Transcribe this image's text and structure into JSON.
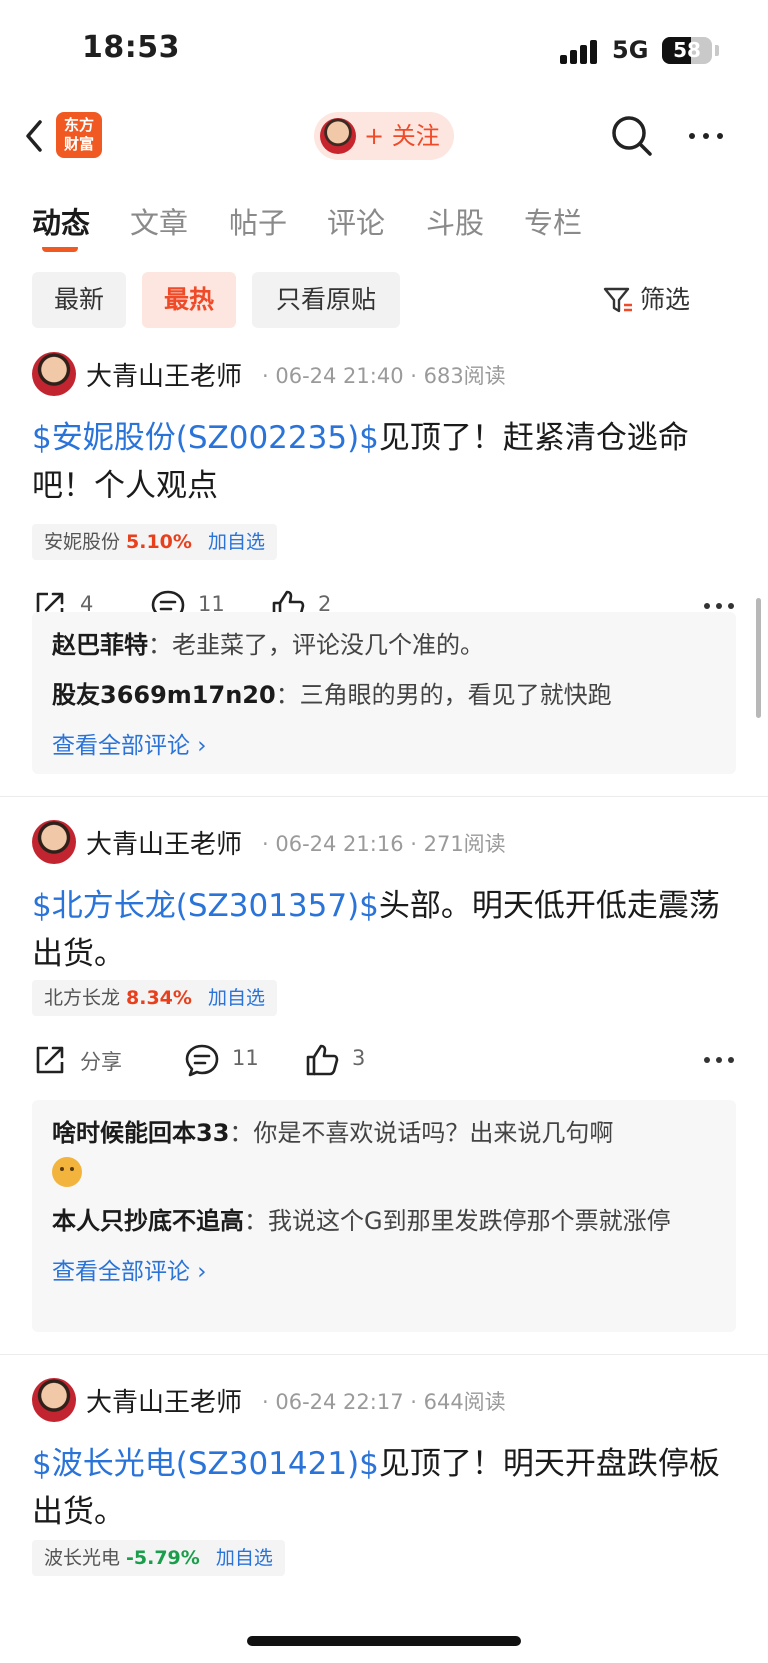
{
  "status_bar": {
    "time": "18:53",
    "network": "5G",
    "battery": "58",
    "battery_fraction": 0.58
  },
  "nav": {
    "logo_text_line1": "东方",
    "logo_text_line2": "财富",
    "follow_label": "+ 关注"
  },
  "tabs": [
    {
      "label": "动态",
      "active": true
    },
    {
      "label": "文章",
      "active": false
    },
    {
      "label": "帖子",
      "active": false
    },
    {
      "label": "评论",
      "active": false
    },
    {
      "label": "斗股",
      "active": false
    },
    {
      "label": "专栏",
      "active": false
    }
  ],
  "filters": {
    "items": [
      "最新",
      "最热",
      "只看原贴"
    ],
    "active_index": 1,
    "filter_label": "筛选"
  },
  "colors": {
    "accent": "#ef4b28",
    "link": "#2a73d8",
    "up": "#e8401c",
    "down": "#1a9e4b"
  },
  "posts": [
    {
      "author": "大青山王老师",
      "meta": "· 06-24 21:40 · 683阅读",
      "stock_link": "$安妮股份(SZ002235)$",
      "text": "见顶了！赶紧清仓逃命吧！个人观点",
      "chip": {
        "name": "安妮股份",
        "pct": "5.10%",
        "add": "加自选"
      },
      "share": "4",
      "comments": "11",
      "likes": "2",
      "replies": [
        {
          "name": "赵巴菲特",
          "text": "：老韭菜了，评论没几个准的。"
        },
        {
          "name": "股友3669m17n20",
          "text": "：三角眼的男的，看见了就快跑"
        }
      ],
      "see_all": "查看全部评论 ›"
    },
    {
      "author": "大青山王老师",
      "meta": "· 06-24 21:16 · 271阅读",
      "stock_link": "$北方长龙(SZ301357)$",
      "text": "头部。明天低开低走震荡出货。",
      "chip": {
        "name": "北方长龙",
        "pct": "8.34%",
        "add": "加自选"
      },
      "share": "分享",
      "comments": "11",
      "likes": "3",
      "replies": [
        {
          "name": "啥时候能回本33",
          "text": "：你是不喜欢说话吗？出来说几句啊"
        },
        {
          "name": "本人只抄底不追高",
          "text": "：我说这个G到那里发跌停那个票就涨停"
        }
      ],
      "see_all": "查看全部评论 ›"
    },
    {
      "author": "大青山王老师",
      "meta": "· 06-24 22:17 · 644阅读",
      "stock_link": "$波长光电(SZ301421)$",
      "text": "见顶了！明天开盘跌停板出货。",
      "chip": {
        "name": "波长光电",
        "pct": "-5.79%",
        "add": "加自选"
      }
    }
  ]
}
